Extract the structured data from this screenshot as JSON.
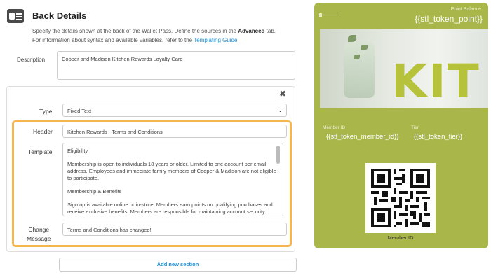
{
  "header": {
    "title": "Back Details",
    "intro_line1_pre": "Specify the details shown at the back of the Wallet Pass. Define the sources in the ",
    "intro_line1_bold": "Advanced",
    "intro_line1_post": " tab.",
    "intro_line2_pre": "For information about syntax and available variables, refer to the ",
    "intro_line2_link": "Templating Guide",
    "intro_line2_post": "."
  },
  "description": {
    "label": "Description",
    "value": "Cooper and Madison Kitchen Rewards Loyalty Card"
  },
  "section": {
    "close_icon": "close-icon",
    "type_label": "Type",
    "type_value": "Fixed Text",
    "header_label": "Header",
    "header_value": "Kitchen Rewards - Terms and Conditions",
    "template_label": "Template",
    "template_paragraphs": [
      "Eligibility",
      "Membership is open to individuals 18 years or older. Limited to one account per email address. Employees and immediate family members of Cooper & Madison are not eligible to participate.",
      "Membership & Benefits",
      "Sign up is available online or in-store. Members earn points on qualifying purchases and receive exclusive benefits. Members are responsible for maintaining account security."
    ],
    "change_label_1": "Change",
    "change_label_2": "Message",
    "change_value": "Terms and Conditions has changed!"
  },
  "add_section_label": "Add new section",
  "pass": {
    "background": "#a8b64a",
    "point_balance_label": "Point Balance",
    "point_balance_value": "{{stl_token_point}}",
    "member_id_label": "Member ID",
    "member_id_value": "{{stl_token_member_id}}",
    "tier_label": "Tier",
    "tier_value": "{{stl_token_tier}}",
    "hero_text": "KIT",
    "qr_caption": "Member ID"
  },
  "colors": {
    "accent_orange": "#f5b650",
    "link_blue": "#1e8fd8"
  }
}
